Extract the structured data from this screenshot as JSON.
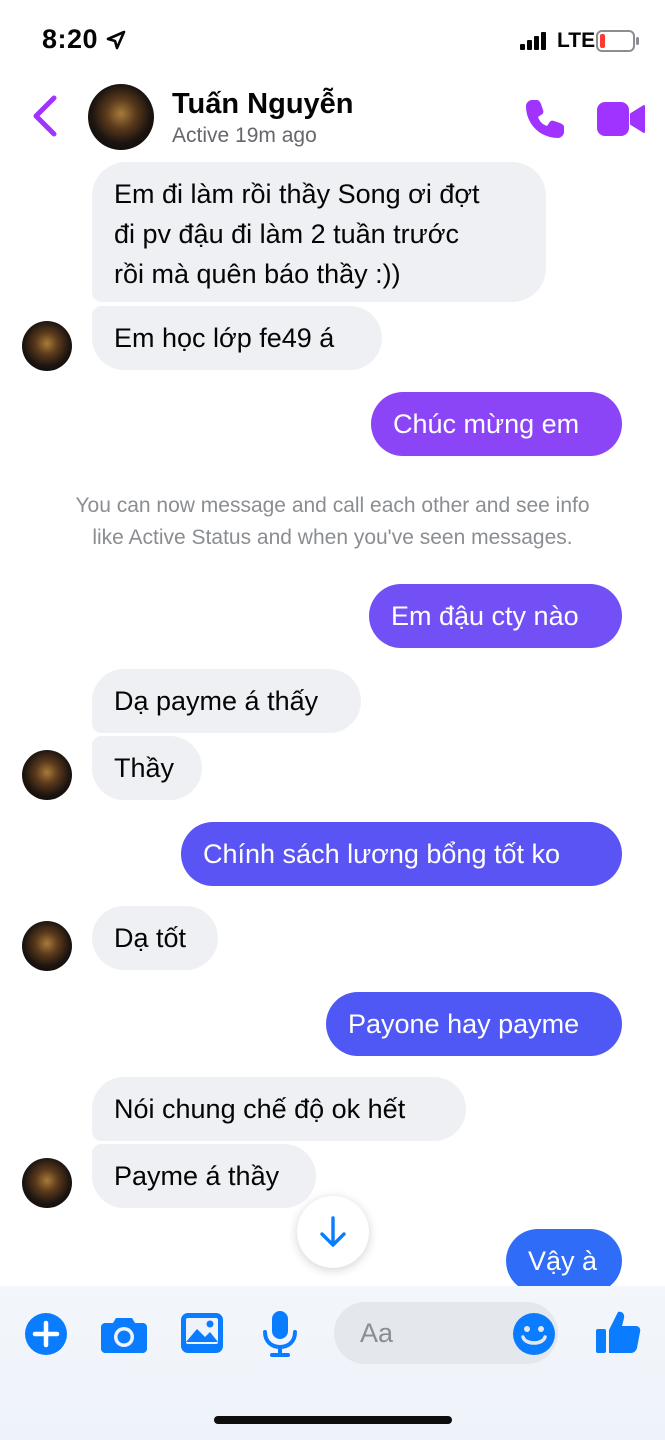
{
  "status_bar": {
    "time": "8:20",
    "network": "LTE"
  },
  "header": {
    "name": "Tuấn Nguyễn",
    "status": "Active 19m ago"
  },
  "messages": [
    {
      "text": "Em đi làm rồi thầy Song ơi đợt\nđi pv đậu đi làm 2 tuần trước\nrồi mà quên báo thầy :))"
    },
    {
      "text": "Em học lớp fe49 á"
    },
    {
      "text": "Chúc mừng em"
    },
    {
      "text": "Em đậu cty nào"
    },
    {
      "text": "Dạ payme á thấy"
    },
    {
      "text": "Thầy"
    },
    {
      "text": "Chính sách lương bổng tốt ko"
    },
    {
      "text": "Dạ tốt"
    },
    {
      "text": "Payone hay payme"
    },
    {
      "text": "Nói chung chế độ ok hết"
    },
    {
      "text": "Payme á thầy"
    },
    {
      "text": "Vậy à"
    }
  ],
  "system_note": "You can now message and call each other and see info\nlike Active Status and when you've seen messages.",
  "composer": {
    "placeholder": "Aa"
  },
  "colors": {
    "accent": "#a033ff",
    "composer_blue": "#0a7cff",
    "out_purple": "#8b44f6",
    "out_blue": "#4f57f5"
  },
  "icons": [
    "location-arrow-icon",
    "signal-icon",
    "battery-icon",
    "back-chevron-icon",
    "phone-icon",
    "video-camera-icon",
    "arrow-down-icon",
    "plus-icon",
    "camera-icon",
    "image-icon",
    "microphone-icon",
    "emoji-icon",
    "thumbs-up-icon"
  ]
}
